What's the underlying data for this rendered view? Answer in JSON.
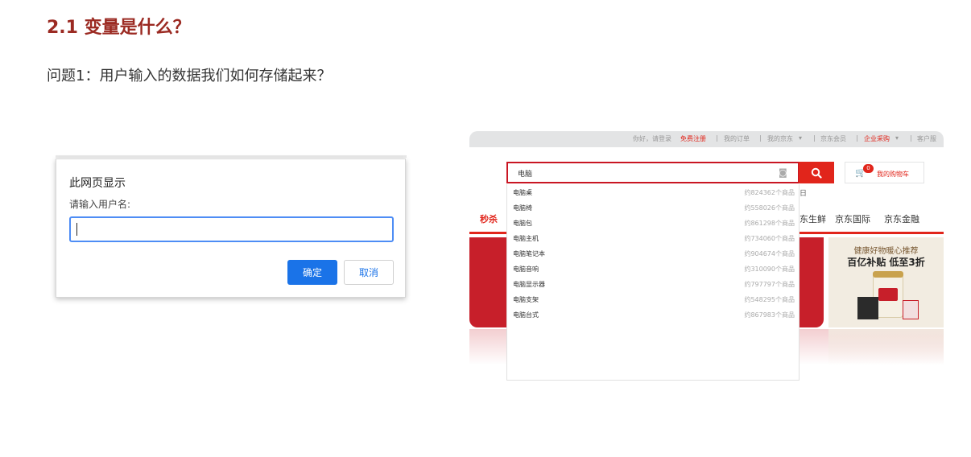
{
  "slide": {
    "title": "2.1 变量是什么？",
    "question": "问题1：用户输入的数据我们如何存储起来？"
  },
  "dialog": {
    "title": "此网页显示",
    "message": "请输入用户名:",
    "input_value": "",
    "ok_label": "确定",
    "cancel_label": "取消"
  },
  "jd": {
    "topbar": {
      "greeting": "你好，请登录",
      "register": "免费注册",
      "orders": "我的订单",
      "myjd": "我的京东",
      "member": "京东会员",
      "enterprise": "企业采购",
      "service": "客户服"
    },
    "search": {
      "value": "电脑",
      "camera_icon": "camera-icon",
      "search_icon": "magnifier-icon"
    },
    "cart": {
      "label": "我的购物车",
      "count": "0"
    },
    "hot_fragment": "日",
    "nav": {
      "miaosha": "秒杀",
      "fresh": "京东生鲜",
      "fresh_visible": "东生鲜",
      "intl": "京东国际",
      "finance": "京东金融"
    },
    "ad": {
      "title": "健康好物暖心推荐",
      "subtitle": "百亿补贴 低至3折"
    },
    "suggestions": [
      {
        "term": "电脑桌",
        "count": "约824362个商品"
      },
      {
        "term": "电脑椅",
        "count": "约558026个商品"
      },
      {
        "term": "电脑包",
        "count": "约861298个商品"
      },
      {
        "term": "电脑主机",
        "count": "约734060个商品"
      },
      {
        "term": "电脑笔记本",
        "count": "约904674个商品"
      },
      {
        "term": "电脑音响",
        "count": "约310090个商品"
      },
      {
        "term": "电脑显示器",
        "count": "约797797个商品"
      },
      {
        "term": "电脑支架",
        "count": "约548295个商品"
      },
      {
        "term": "电脑台式",
        "count": "约867983个商品"
      }
    ],
    "colors": {
      "brand_red": "#e1251b",
      "dialog_blue": "#1a73e8",
      "title_red": "#9b2a22"
    }
  }
}
